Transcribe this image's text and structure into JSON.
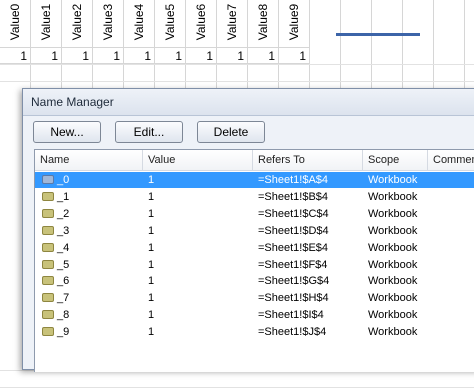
{
  "sheet": {
    "columns": [
      {
        "header": "Value0",
        "value": "1"
      },
      {
        "header": "Value1",
        "value": "1"
      },
      {
        "header": "Value2",
        "value": "1"
      },
      {
        "header": "Value3",
        "value": "1"
      },
      {
        "header": "Value4",
        "value": "1"
      },
      {
        "header": "Value5",
        "value": "1"
      },
      {
        "header": "Value6",
        "value": "1"
      },
      {
        "header": "Value7",
        "value": "1"
      },
      {
        "header": "Value8",
        "value": "1"
      },
      {
        "header": "Value9",
        "value": "1"
      }
    ],
    "chart_line_color": "#3c64a8"
  },
  "dialog": {
    "title": "Name Manager",
    "buttons": {
      "new": "New...",
      "edit": "Edit...",
      "delete": "Delete"
    },
    "columns": {
      "name": "Name",
      "value": "Value",
      "refers_to": "Refers To",
      "scope": "Scope",
      "comment": "Comment"
    },
    "rows": [
      {
        "name": "_0",
        "value": "1",
        "refers_to": "=Sheet1!$A$4",
        "scope": "Workbook",
        "selected": true
      },
      {
        "name": "_1",
        "value": "1",
        "refers_to": "=Sheet1!$B$4",
        "scope": "Workbook"
      },
      {
        "name": "_2",
        "value": "1",
        "refers_to": "=Sheet1!$C$4",
        "scope": "Workbook"
      },
      {
        "name": "_3",
        "value": "1",
        "refers_to": "=Sheet1!$D$4",
        "scope": "Workbook"
      },
      {
        "name": "_4",
        "value": "1",
        "refers_to": "=Sheet1!$E$4",
        "scope": "Workbook"
      },
      {
        "name": "_5",
        "value": "1",
        "refers_to": "=Sheet1!$F$4",
        "scope": "Workbook"
      },
      {
        "name": "_6",
        "value": "1",
        "refers_to": "=Sheet1!$G$4",
        "scope": "Workbook"
      },
      {
        "name": "_7",
        "value": "1",
        "refers_to": "=Sheet1!$H$4",
        "scope": "Workbook"
      },
      {
        "name": "_8",
        "value": "1",
        "refers_to": "=Sheet1!$I$4",
        "scope": "Workbook"
      },
      {
        "name": "_9",
        "value": "1",
        "refers_to": "=Sheet1!$J$4",
        "scope": "Workbook"
      }
    ],
    "selection_color": "#3399ff"
  }
}
